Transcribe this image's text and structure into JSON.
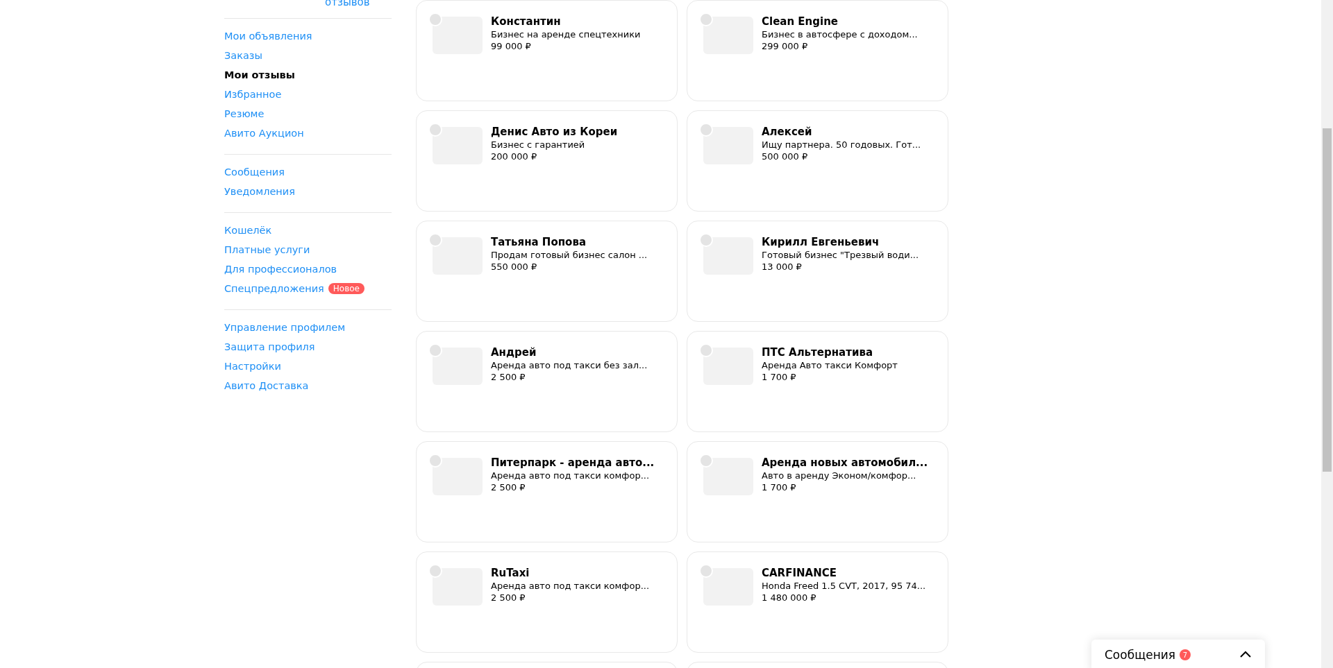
{
  "sidebar": {
    "header_link": "отзывов",
    "groups": [
      [
        {
          "label": "Мои объявления",
          "selected": false
        },
        {
          "label": "Заказы",
          "selected": false
        },
        {
          "label": "Мои отзывы",
          "selected": true
        },
        {
          "label": "Избранное",
          "selected": false
        },
        {
          "label": "Резюме",
          "selected": false
        },
        {
          "label": "Авито Аукцион",
          "selected": false
        }
      ],
      [
        {
          "label": "Сообщения",
          "selected": false
        },
        {
          "label": "Уведомления",
          "selected": false
        }
      ],
      [
        {
          "label": "Кошелёк",
          "selected": false
        },
        {
          "label": "Платные услуги",
          "selected": false
        },
        {
          "label": "Для профессионалов",
          "selected": false
        },
        {
          "label": "Спецпредложения",
          "selected": false,
          "badge": "Новое"
        }
      ],
      [
        {
          "label": "Управление профилем",
          "selected": false
        },
        {
          "label": "Защита профиля",
          "selected": false
        },
        {
          "label": "Настройки",
          "selected": false
        },
        {
          "label": "Авито Доставка",
          "selected": false
        }
      ]
    ]
  },
  "cards": [
    {
      "kind": "listing",
      "title": "Константин",
      "description": "Бизнес на аренде спецтехники",
      "price": "99 000 ₽"
    },
    {
      "kind": "listing",
      "title": "Clean Engine",
      "description": "Бизнес в автосфере с доходом...",
      "price": "299 000 ₽"
    },
    {
      "kind": "listing",
      "title": "Денис Авто из Кореи",
      "description": "Бизнес с гарантией",
      "price": "200 000 ₽"
    },
    {
      "kind": "listing",
      "title": "Алексей",
      "description": "Ищу партнера. 50 годовых. Гот...",
      "price": "500 000 ₽"
    },
    {
      "kind": "listing",
      "title": "Татьяна Попова",
      "description": "Продам готовый бизнес салон ...",
      "price": "550 000 ₽"
    },
    {
      "kind": "listing",
      "title": "Кирилл Евгеньевич",
      "description": "Готовый бизнес \"Трезвый води...",
      "price": "13 000 ₽"
    },
    {
      "kind": "listing",
      "title": "Андрей",
      "description": "Аренда авто под такси без зал...",
      "price": "2 500 ₽"
    },
    {
      "kind": "listing",
      "title": "ПТС Альтернатива",
      "description": "Аренда Авто такси Комфорт",
      "price": "1 700 ₽"
    },
    {
      "kind": "listing",
      "title": "Питерпарк - аренда авто...",
      "description": "Аренда авто под такси комфор...",
      "price": "2 500 ₽"
    },
    {
      "kind": "listing",
      "title": "Аренда новых автомобил...",
      "description": "Авто в аренду Эконом/комфор...",
      "price": "1 700 ₽"
    },
    {
      "kind": "listing",
      "title": "RuTaxi",
      "description": "Аренда авто под такси комфор...",
      "price": "2 500 ₽"
    },
    {
      "kind": "listing",
      "title": "CARFINANCE",
      "description": "Honda Freed 1.5 CVT, 2017, 95 74...",
      "price": "1 480 000 ₽"
    },
    {
      "kind": "clipped"
    },
    {
      "kind": "clipped"
    }
  ],
  "messages_widget": {
    "title": "Сообщения",
    "count": "7",
    "expanded": false
  }
}
